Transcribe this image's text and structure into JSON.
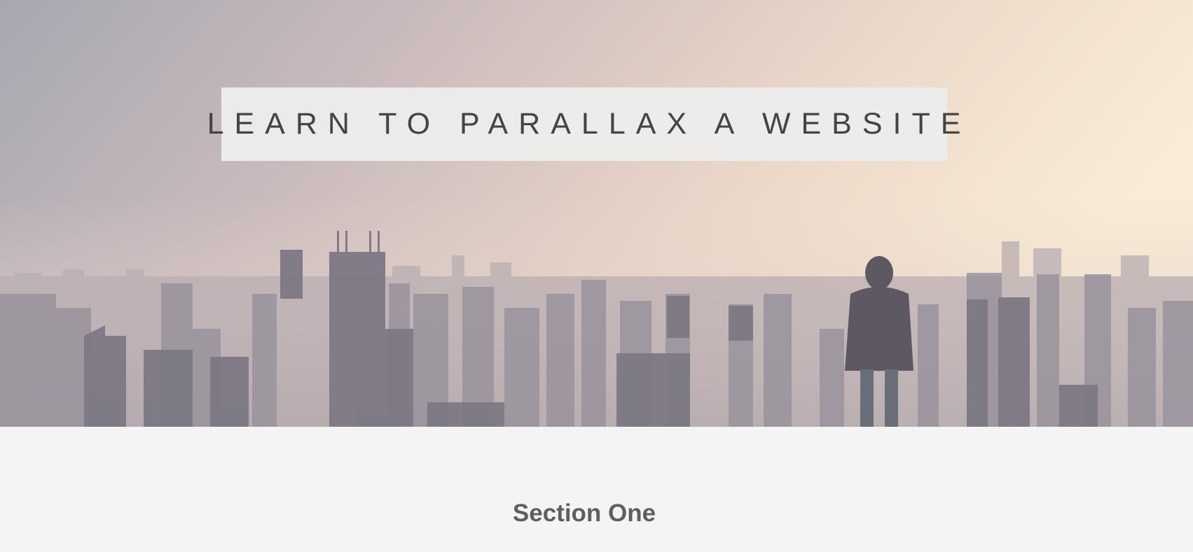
{
  "hero": {
    "title": "LEARN TO PARALLAX A WEBSITE",
    "image_alt": "hooded-person-overlooking-hazy-city-skyline"
  },
  "section_one": {
    "heading": "Section One"
  },
  "colors": {
    "title_box_bg": "#ececec",
    "title_text": "#444444",
    "page_bg": "#f4f4f4",
    "section_heading": "#5f5f5f"
  }
}
